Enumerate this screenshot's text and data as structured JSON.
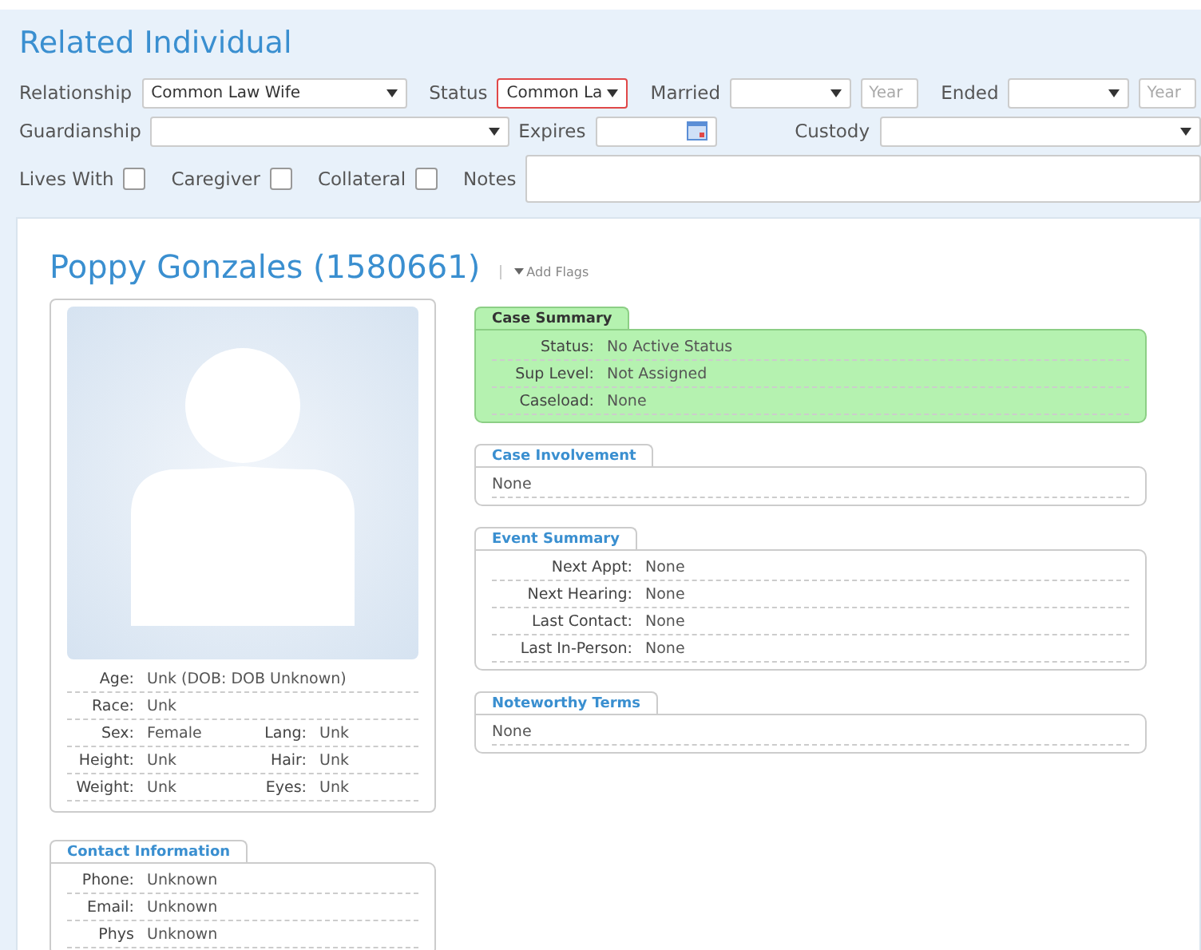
{
  "form": {
    "title": "Related Individual",
    "row_1": [
      {
        "kind": "select",
        "label": "Relationship",
        "value": "Common Law Wife",
        "invalid": false
      },
      {
        "kind": "select",
        "label": "Status",
        "value": "Common La",
        "invalid": true
      },
      {
        "kind": "select",
        "label": "Married",
        "invalid": false
      },
      {
        "kind": "year",
        "placeholder": "Year"
      },
      {
        "kind": "select",
        "label": "Ended",
        "invalid": false
      },
      {
        "kind": "year",
        "placeholder": "Year"
      }
    ],
    "row_2": [
      {
        "kind": "select",
        "label": "Guardianship",
        "invalid": false
      },
      {
        "kind": "date",
        "label": "Expires"
      },
      {
        "kind": "select",
        "label": "Custody",
        "invalid": false
      }
    ],
    "row_3": [
      {
        "kind": "checkbox",
        "label": "Lives With",
        "checked": false
      },
      {
        "kind": "checkbox",
        "label": "Caregiver",
        "checked": false
      },
      {
        "kind": "checkbox",
        "label": "Collateral",
        "checked": false
      },
      {
        "kind": "notes",
        "label": "Notes"
      }
    ]
  },
  "person": {
    "name": "Poppy Gonzales (1580661)",
    "add_flags": "Add Flags",
    "details": [
      {
        "cells": [
          {
            "label": "Age:",
            "value": "Unk  (DOB: DOB Unknown)"
          }
        ]
      },
      {
        "cells": [
          {
            "label": "Race:",
            "value": "Unk"
          }
        ]
      },
      {
        "cells": [
          {
            "label": "Sex:",
            "value": "Female"
          },
          {
            "label": "Lang:",
            "value": "Unk"
          }
        ]
      },
      {
        "cells": [
          {
            "label": "Height:",
            "value": "Unk"
          },
          {
            "label": "Hair:",
            "value": "Unk"
          }
        ]
      },
      {
        "cells": [
          {
            "label": "Weight:",
            "value": "Unk"
          },
          {
            "label": "Eyes:",
            "value": "Unk"
          }
        ]
      }
    ],
    "contact": {
      "title": "Contact Information",
      "rows": [
        {
          "label": "Phone:",
          "value": "Unknown"
        },
        {
          "label": "Email:",
          "value": "Unknown"
        },
        {
          "label": "Phys",
          "value": "Unknown"
        }
      ]
    }
  },
  "panels": [
    {
      "title": "Case Summary",
      "highlighted": true,
      "rows": [
        {
          "label": "Status:",
          "value": "No Active Status"
        },
        {
          "label": "Sup Level:",
          "value": "Not Assigned"
        },
        {
          "label": "Caseload:",
          "value": "None"
        }
      ]
    },
    {
      "title": "Case Involvement",
      "highlighted": false,
      "rows": [
        {
          "value": "None"
        }
      ]
    },
    {
      "title": "Event Summary",
      "highlighted": false,
      "rows": [
        {
          "label": "Next Appt:",
          "value": "None"
        },
        {
          "label": "Next Hearing:",
          "value": "None"
        },
        {
          "label": "Last Contact:",
          "value": "None"
        },
        {
          "label": "Last In-Person:",
          "value": "None"
        }
      ]
    },
    {
      "title": "Noteworthy Terms",
      "highlighted": false,
      "rows": [
        {
          "value": "None"
        }
      ]
    }
  ]
}
